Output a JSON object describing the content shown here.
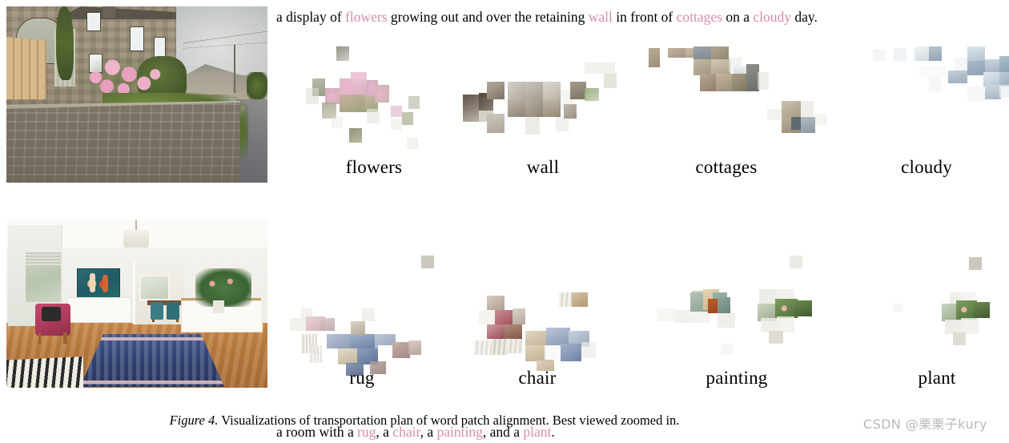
{
  "figure": {
    "number_label": "Figure 4.",
    "caption_text": "Visualizations of transportation plan of word patch alignment. Best viewed zoomed in.",
    "watermark": "CSDN @栗栗子kury",
    "highlight_color": "#d88cad"
  },
  "rows": [
    {
      "image_alt": "village-street-photo",
      "sentence_parts": [
        {
          "text": "a display of ",
          "highlight": false
        },
        {
          "text": "flowers",
          "highlight": true
        },
        {
          "text": " growing out and over the retaining ",
          "highlight": false
        },
        {
          "text": "wall",
          "highlight": true
        },
        {
          "text": " in front of ",
          "highlight": false
        },
        {
          "text": "cottages",
          "highlight": true
        },
        {
          "text": " on a ",
          "highlight": false
        },
        {
          "text": "cloudy",
          "highlight": true
        },
        {
          "text": " day.",
          "highlight": false
        }
      ],
      "panels": [
        {
          "word": "flowers",
          "theme": "pink-flowers"
        },
        {
          "word": "wall",
          "theme": "grey-stone"
        },
        {
          "word": "cottages",
          "theme": "brick-house"
        },
        {
          "word": "cloudy",
          "theme": "blue-sky"
        }
      ]
    },
    {
      "image_alt": "living-room-photo",
      "sentence_parts": [
        {
          "text": "a room with a ",
          "highlight": false
        },
        {
          "text": "rug",
          "highlight": true
        },
        {
          "text": ", a ",
          "highlight": false
        },
        {
          "text": "chair",
          "highlight": true
        },
        {
          "text": ", a ",
          "highlight": false
        },
        {
          "text": "painting",
          "highlight": true
        },
        {
          "text": ", and a ",
          "highlight": false
        },
        {
          "text": "plant",
          "highlight": true
        },
        {
          "text": ".",
          "highlight": false
        }
      ],
      "panels": [
        {
          "word": "rug",
          "theme": "navy-rug"
        },
        {
          "word": "chair",
          "theme": "red-chair"
        },
        {
          "word": "painting",
          "theme": "teal-artwork"
        },
        {
          "word": "plant",
          "theme": "green-bouquet"
        }
      ]
    }
  ]
}
